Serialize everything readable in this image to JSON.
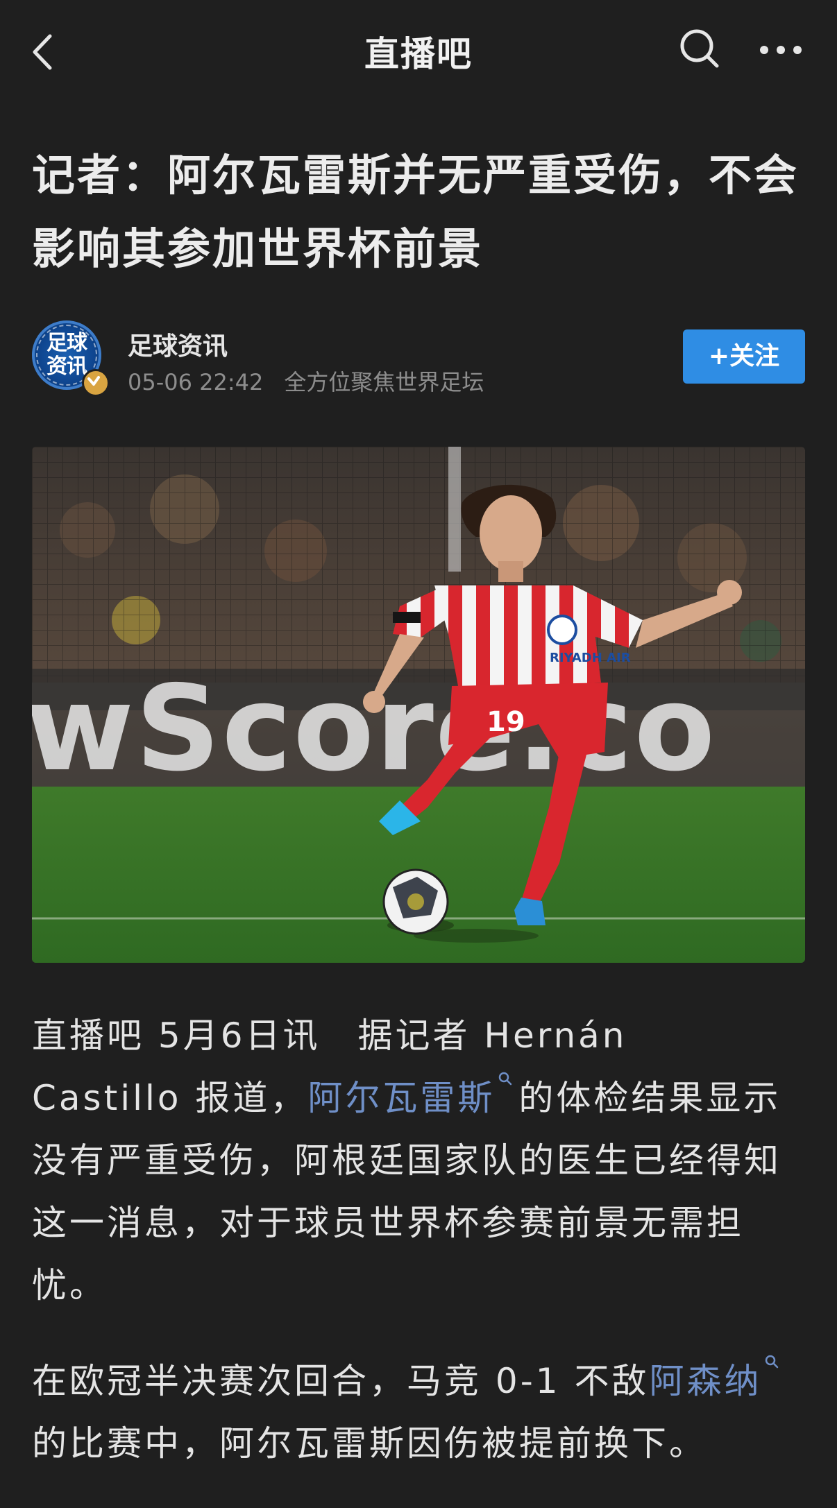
{
  "nav": {
    "title": "直播吧",
    "back_icon": "back-arrow-icon",
    "search_icon": "search-icon",
    "more_icon": "more-dots-icon"
  },
  "article": {
    "title": "记者：阿尔瓦雷斯并无严重受伤，不会影响其参加世界杯前景"
  },
  "author": {
    "name": "足球资讯",
    "avatar_text": "足球资讯",
    "time": "05-06 22:42",
    "bio": "全方位聚焦世界足坛",
    "follow_label": "+关注",
    "follow_color": "#2f8de4"
  },
  "photo": {
    "ad_board_text": "wScore.co",
    "jersey_number": "19",
    "sponsor": "RIYADH AIR"
  },
  "body": {
    "p1_a": "直播吧 5月6日讯　据记者 Hernán　Castillo 报道，",
    "p1_kw": "阿尔瓦雷斯",
    "p1_b": "的体检结果显示没有严重受伤，阿根廷国家队的医生已经得知这一消息，对于球员世界杯参赛前景无需担忧。",
    "p2_a": "在欧冠半决赛次回合，马竞 0-1 不敌",
    "p2_kw": "阿森纳",
    "p2_b": "的比赛中，阿尔瓦雷斯因伤被提前换下。",
    "keyword_color": "#6f8fc7"
  }
}
